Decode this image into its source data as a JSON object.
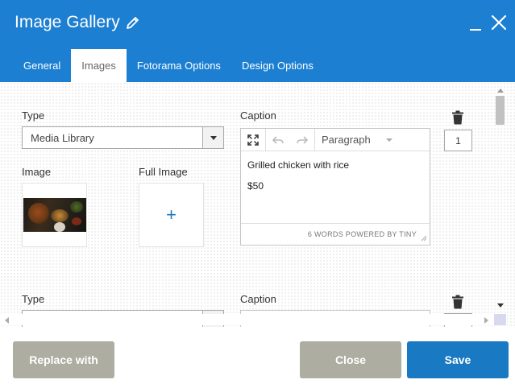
{
  "dialog": {
    "title": "Image Gallery"
  },
  "tabs": [
    {
      "label": "General",
      "active": false
    },
    {
      "label": "Images",
      "active": true
    },
    {
      "label": "Fotorama Options",
      "active": false
    },
    {
      "label": "Design Options",
      "active": false
    }
  ],
  "items": [
    {
      "type_label": "Type",
      "type_value": "Media Library",
      "image_label": "Image",
      "full_image_label": "Full Image",
      "caption_label": "Caption",
      "editor": {
        "format": "Paragraph",
        "lines": [
          "Grilled chicken with rice",
          "$50"
        ],
        "status": "6 WORDS POWERED BY TINY"
      },
      "order": "1"
    },
    {
      "type_label": "Type",
      "caption_label": "Caption"
    }
  ],
  "footer": {
    "replace_label": "Replace with",
    "close_label": "Close",
    "save_label": "Save"
  },
  "colors": {
    "header": "#1c7fd1",
    "primary_button": "#1979c3",
    "secondary_button": "#adada1"
  },
  "icons": [
    "pencil-icon",
    "minimize-icon",
    "close-icon",
    "fullscreen-icon",
    "undo-icon",
    "redo-icon",
    "trash-icon",
    "plus-icon"
  ]
}
